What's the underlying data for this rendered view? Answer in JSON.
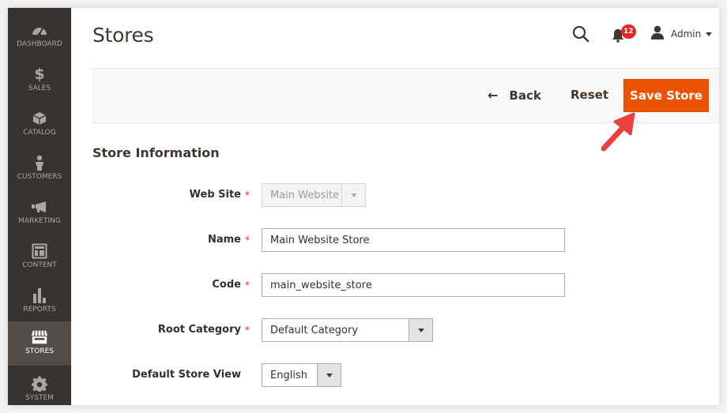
{
  "sidebar": {
    "items": [
      {
        "label": "DASHBOARD",
        "icon": "dashboard-icon"
      },
      {
        "label": "SALES",
        "icon": "dollar-icon"
      },
      {
        "label": "CATALOG",
        "icon": "box-icon"
      },
      {
        "label": "CUSTOMERS",
        "icon": "person-icon"
      },
      {
        "label": "MARKETING",
        "icon": "megaphone-icon"
      },
      {
        "label": "CONTENT",
        "icon": "layout-icon"
      },
      {
        "label": "REPORTS",
        "icon": "bar-chart-icon"
      },
      {
        "label": "STORES",
        "icon": "storefront-icon",
        "active": true
      },
      {
        "label": "SYSTEM",
        "icon": "gear-icon"
      }
    ]
  },
  "header": {
    "title": "Stores",
    "notifications_count": "12",
    "user_name": "Admin"
  },
  "actions": {
    "back_label": "Back",
    "reset_label": "Reset",
    "save_label": "Save Store"
  },
  "colors": {
    "accent": "#eb5202",
    "sidebar_bg": "#373330",
    "required": "#e22626",
    "annotation_arrow": "#e8413e"
  },
  "form": {
    "section_title": "Store Information",
    "fields": [
      {
        "label": "Web Site",
        "value": "Main Website",
        "required": true,
        "type": "select",
        "disabled": true
      },
      {
        "label": "Name",
        "value": "Main Website Store",
        "required": true,
        "type": "text"
      },
      {
        "label": "Code",
        "value": "main_website_store",
        "required": true,
        "type": "text"
      },
      {
        "label": "Root Category",
        "value": "Default Category",
        "required": true,
        "type": "select"
      },
      {
        "label": "Default Store View",
        "value": "English",
        "required": false,
        "type": "select"
      }
    ]
  }
}
